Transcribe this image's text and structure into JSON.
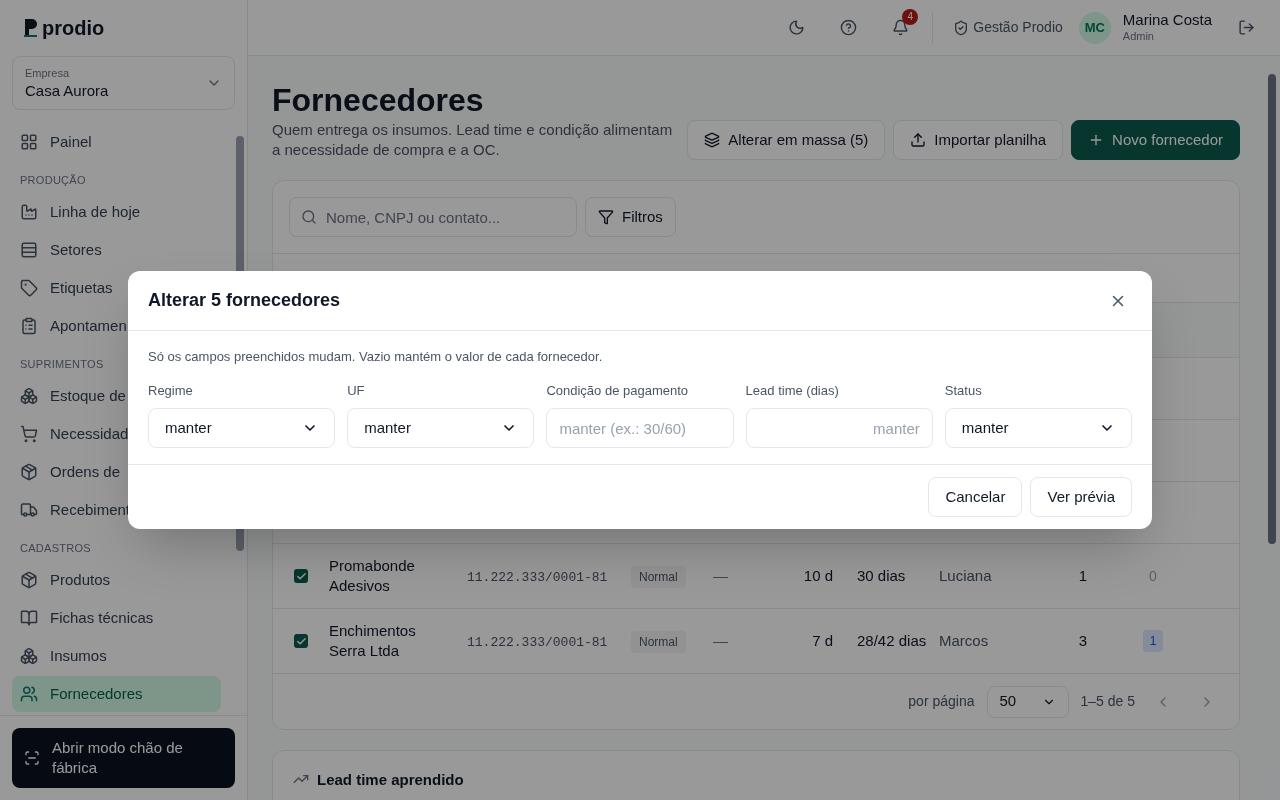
{
  "brand": "prodio",
  "company": {
    "label": "Empresa",
    "value": "Casa Aurora"
  },
  "sidebar": {
    "sections": [
      {
        "items": [
          {
            "label": "Painel",
            "selected": false
          }
        ]
      },
      {
        "title": "PRODUÇÃO",
        "items": [
          {
            "label": "Linha de hoje",
            "selected": false
          },
          {
            "label": "Setores",
            "selected": false
          },
          {
            "label": "Etiquetas",
            "selected": false
          },
          {
            "label": "Apontamen",
            "selected": false
          }
        ]
      },
      {
        "title": "SUPRIMENTOS",
        "items": [
          {
            "label": "Estoque de",
            "selected": false
          },
          {
            "label": "Necessidad",
            "selected": false
          },
          {
            "label": "Ordens de",
            "selected": false
          },
          {
            "label": "Recebiment",
            "selected": false
          }
        ]
      },
      {
        "title": "CADASTROS",
        "items": [
          {
            "label": "Produtos",
            "selected": false
          },
          {
            "label": "Fichas técnicas",
            "selected": false
          },
          {
            "label": "Insumos",
            "selected": false
          },
          {
            "label": "Fornecedores",
            "selected": true
          }
        ]
      }
    ],
    "floor_button": "Abrir modo chão de fábrica"
  },
  "topbar": {
    "notifications": "4",
    "workspace": "Gestão Prodio",
    "user": {
      "initials": "MC",
      "name": "Marina Costa",
      "role": "Admin"
    }
  },
  "page": {
    "title": "Fornecedores",
    "subtitle": "Quem entrega os insumos. Lead time e condição alimentam a necessidade de compra e a OC.",
    "actions": [
      {
        "label": "Alterar em massa (5)",
        "kind": "bulk"
      },
      {
        "label": "Importar planilha",
        "kind": "import"
      },
      {
        "label": "Novo fornecedor",
        "kind": "new"
      }
    ]
  },
  "table": {
    "search_placeholder": "Nome, CNPJ ou contato...",
    "filters": "Filtros",
    "rows": [
      {
        "checked": true,
        "name": "Promabonde Adesivos",
        "cnpj": "11.222.333/0001-81",
        "regime": "Normal",
        "column_5": "—",
        "column_6": "10 d",
        "column_7": "30 dias",
        "column_8": "Luciana",
        "column_9": "1",
        "column_10": {
          "text": "0",
          "kind": "plain"
        }
      },
      {
        "checked": true,
        "name": "Enchimentos Serra Ltda",
        "cnpj": "11.222.333/0001-81",
        "regime": "Normal",
        "column_5": "—",
        "column_6": "7 d",
        "column_7": "28/42 dias",
        "column_8": "Marcos",
        "column_9": "3",
        "column_10": {
          "text": "1",
          "kind": "badge"
        }
      }
    ],
    "per_page_label": "por página",
    "per_page": "50",
    "range": "1–5 de 5"
  },
  "next_card": {
    "title": "Lead time aprendido"
  },
  "dialog": {
    "title": "Alterar 5 fornecedores",
    "note": "Só os campos preenchidos mudam. Vazio mantém o valor de cada fornecedor.",
    "fields": [
      {
        "label": "Regime",
        "kind": "select",
        "value": "manter"
      },
      {
        "label": "UF",
        "kind": "select",
        "value": "manter"
      },
      {
        "label": "Condição de pagamento",
        "kind": "text",
        "placeholder": "manter (ex.: 30/60)"
      },
      {
        "label": "Lead time (dias)",
        "kind": "number",
        "placeholder": "manter"
      },
      {
        "label": "Status",
        "kind": "select",
        "value": "manter"
      }
    ],
    "buttons": [
      "Cancelar",
      "Ver prévia"
    ]
  }
}
